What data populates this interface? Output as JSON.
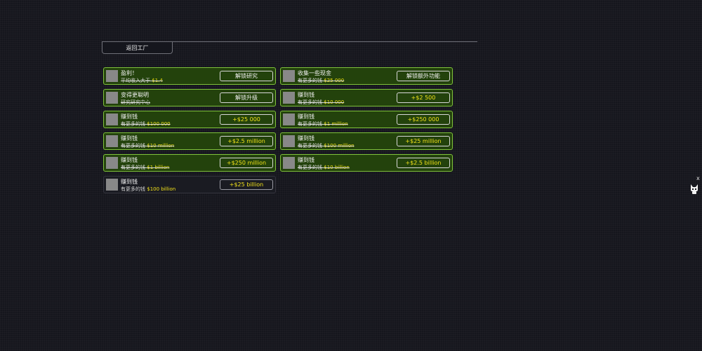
{
  "back_button": {
    "label": "返回工厂"
  },
  "achievements": [
    {
      "title": "盈利！",
      "desc_prefix": "平均收入大于 ",
      "value": "$1.4",
      "button": "解锁研究",
      "button_money": false,
      "completed": true,
      "col": 0,
      "row": 0
    },
    {
      "title": "收集一些现金",
      "desc_prefix": "有更多的钱 ",
      "value": "$25 000",
      "button": "解锁额外功能",
      "button_money": false,
      "completed": true,
      "col": 1,
      "row": 0
    },
    {
      "title": "变得更聪明",
      "desc_prefix": "研究研究中心",
      "value": "",
      "button": "解锁升级",
      "button_money": false,
      "completed": true,
      "col": 0,
      "row": 1
    },
    {
      "title": "赚到钱",
      "desc_prefix": "有更多的钱 ",
      "value": "$10 000",
      "button": "+$2 500",
      "button_money": true,
      "completed": true,
      "col": 1,
      "row": 1
    },
    {
      "title": "赚到钱",
      "desc_prefix": "有更多的钱 ",
      "value": "$100 000",
      "button": "+$25 000",
      "button_money": true,
      "completed": true,
      "col": 0,
      "row": 2
    },
    {
      "title": "赚到钱",
      "desc_prefix": "有更多的钱 ",
      "value": "$1 million",
      "button": "+$250 000",
      "button_money": true,
      "completed": true,
      "col": 1,
      "row": 2
    },
    {
      "title": "赚到钱",
      "desc_prefix": "有更多的钱 ",
      "value": "$10 million",
      "button": "+$2.5 million",
      "button_money": true,
      "completed": true,
      "col": 0,
      "row": 3
    },
    {
      "title": "赚到钱",
      "desc_prefix": "有更多的钱 ",
      "value": "$100 million",
      "button": "+$25 million",
      "button_money": true,
      "completed": true,
      "col": 1,
      "row": 3
    },
    {
      "title": "赚到钱",
      "desc_prefix": "有更多的钱 ",
      "value": "$1 billion",
      "button": "+$250 million",
      "button_money": true,
      "completed": true,
      "col": 0,
      "row": 4
    },
    {
      "title": "赚到钱",
      "desc_prefix": "有更多的钱 ",
      "value": "$10 billion",
      "button": "+$2.5 billion",
      "button_money": true,
      "completed": true,
      "col": 1,
      "row": 4
    },
    {
      "title": "赚到钱",
      "desc_prefix": "有更多的钱 ",
      "value": "$100 billion",
      "button": "+$25 billion",
      "button_money": true,
      "completed": false,
      "col": 0,
      "row": 5
    }
  ],
  "side_widget": {
    "close_label": "x",
    "icon": "cat-mascot-icon"
  },
  "colors": {
    "background": "#15161d",
    "card_done_bg": "#23420c",
    "card_done_border": "#7fc23a",
    "money_yellow": "#f2e21a"
  }
}
